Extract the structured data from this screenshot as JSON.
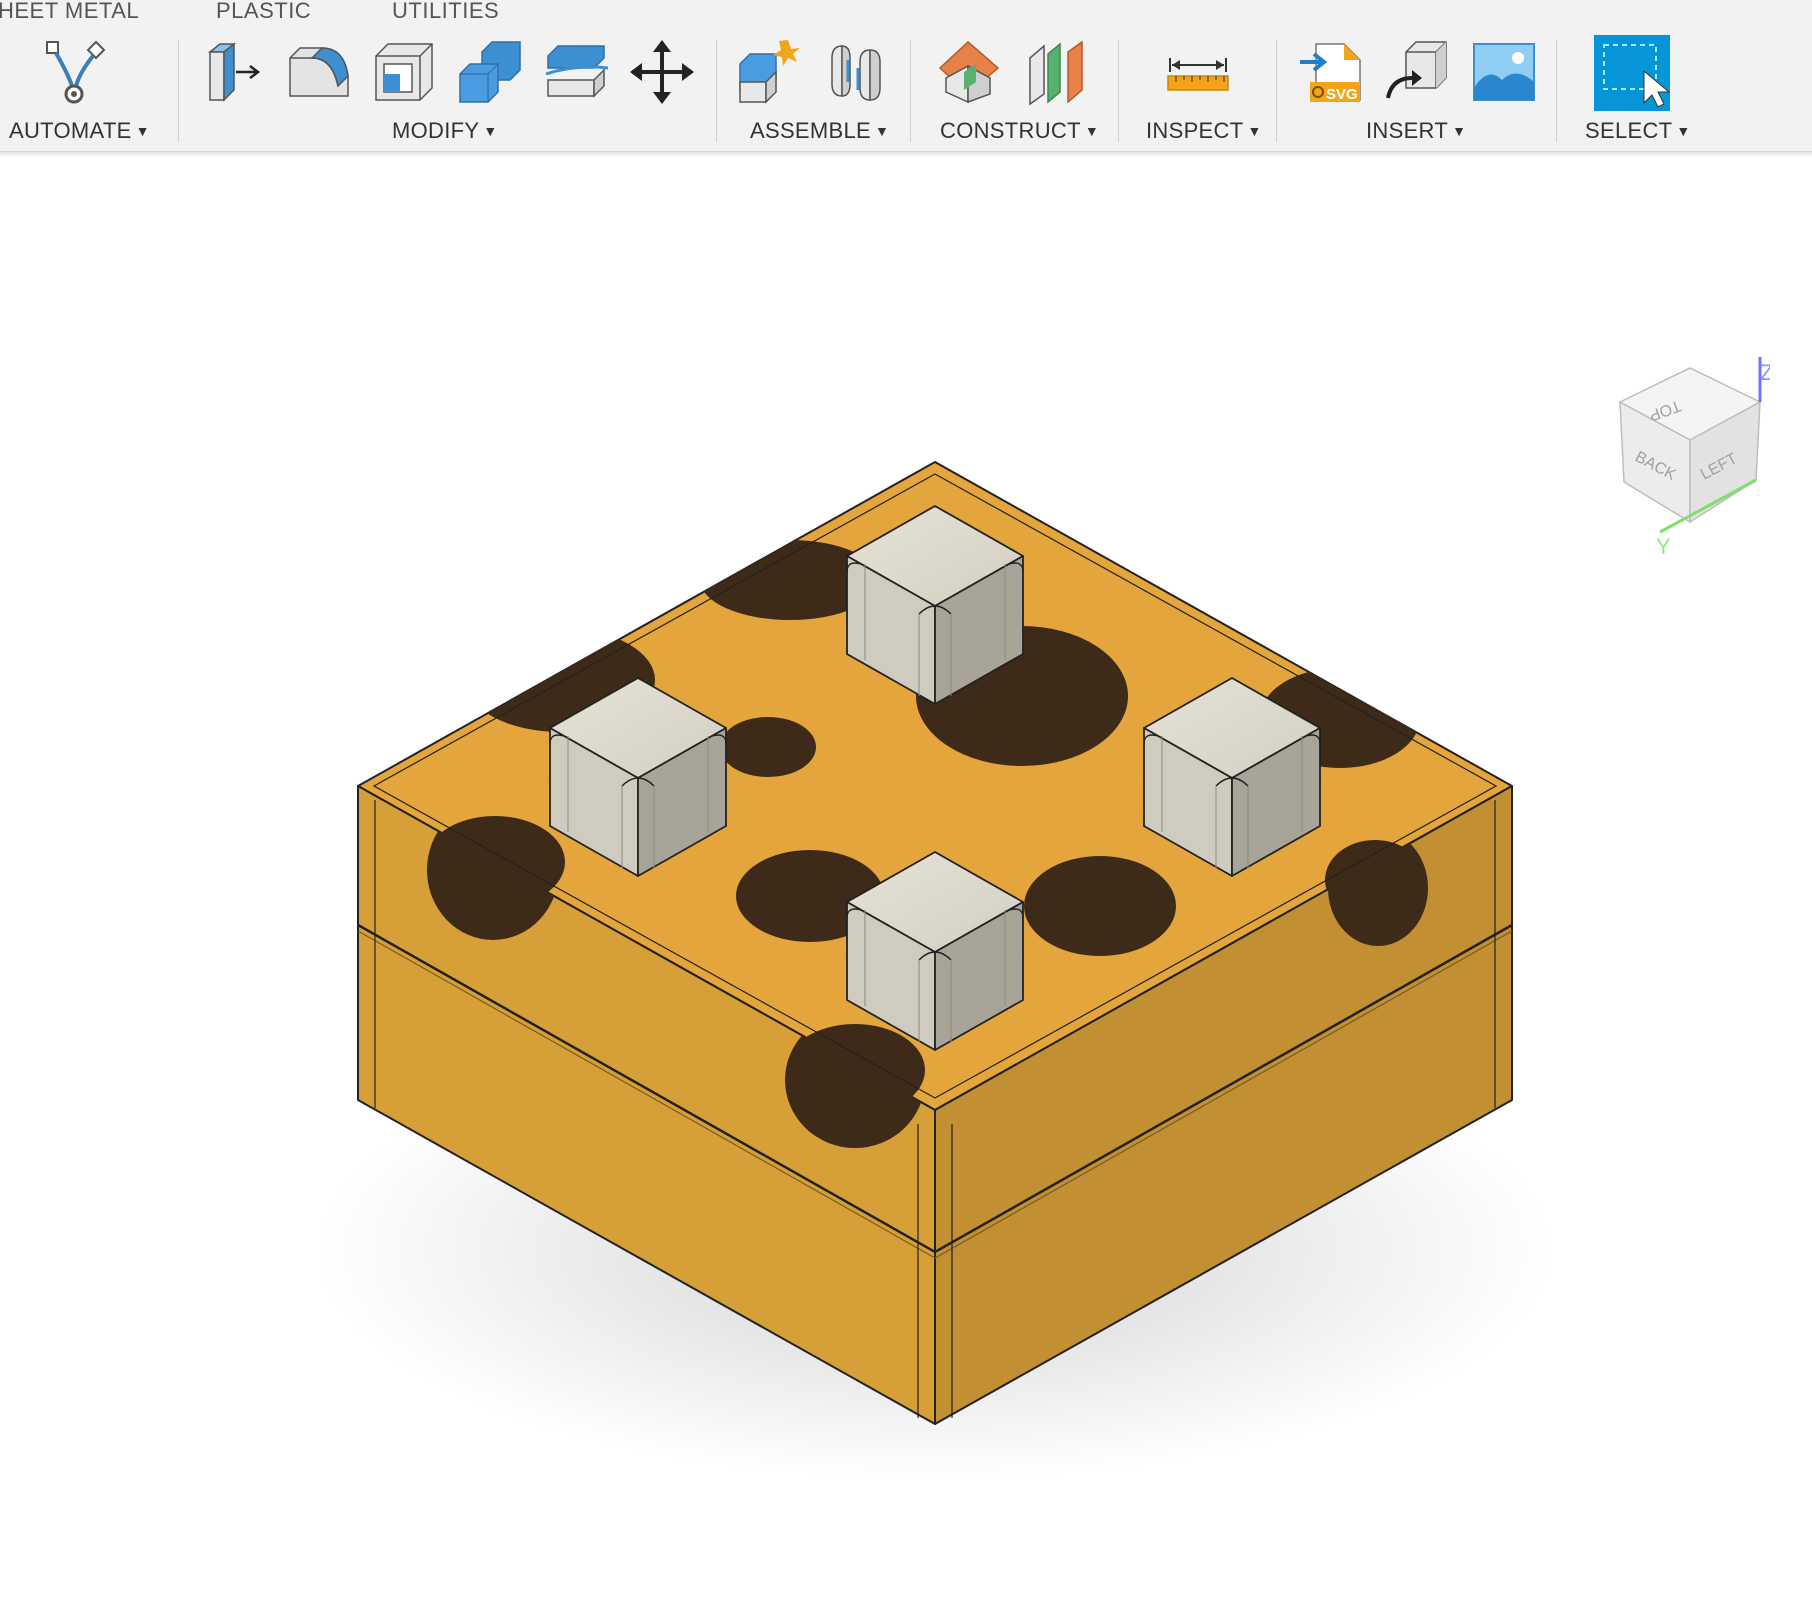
{
  "tabs": {
    "sheet_metal": "HEET METAL",
    "plastic": "PLASTIC",
    "utilities": "UTILITIES"
  },
  "groups": {
    "automate": "AUTOMATE",
    "modify": "MODIFY",
    "assemble": "ASSEMBLE",
    "construct": "CONSTRUCT",
    "inspect": "INSPECT",
    "insert": "INSERT",
    "select": "SELECT"
  },
  "icons": {
    "automate": "automate-node-icon",
    "press_pull": "press-pull-icon",
    "fillet": "fillet-icon",
    "shell": "shell-icon",
    "combine": "combine-icon",
    "split_face": "split-face-icon",
    "move": "move-icon",
    "new_component": "new-component-icon",
    "joint": "joint-icon",
    "offset_plane": "offset-plane-icon",
    "midplane": "midplane-icon",
    "measure": "measure-icon",
    "insert_svg": "insert-svg-icon",
    "insert_mesh": "insert-mesh-icon",
    "canvas": "canvas-image-icon",
    "select": "window-select-icon"
  },
  "insert_svg_badge": "SVG",
  "viewcube": {
    "faces": {
      "top": "TOP",
      "back": "BACK",
      "left": "LEFT"
    },
    "axes": {
      "z": "Z",
      "y": "Y"
    }
  },
  "colors": {
    "toolbar_bg": "#f2f2f2",
    "accent_blue": "#0696d7",
    "body_orange": "#e3a53c",
    "spot_brown": "#3d2a18",
    "key_grey": "#d8d4c8"
  }
}
